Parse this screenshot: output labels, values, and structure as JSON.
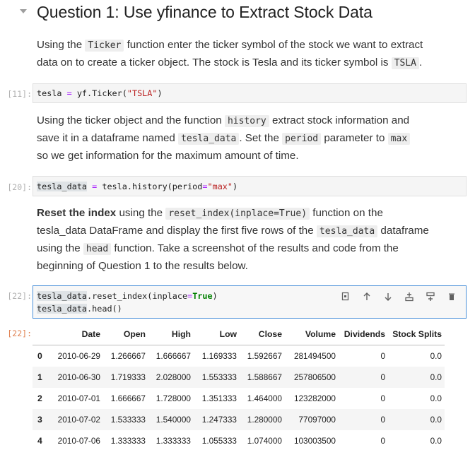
{
  "heading": {
    "title": "Question 1: Use yfinance to Extract Stock Data"
  },
  "md1": {
    "t1": "Using the ",
    "c1": "Ticker",
    "t2": " function enter the ticker symbol of the stock we want to extract",
    "t3": "data on to create a ticker object. The stock is Tesla and its ticker symbol is ",
    "c2": "TSLA",
    "t4": "."
  },
  "cell11": {
    "prompt": "[11]:",
    "a": "tesla",
    "op": " = ",
    "b": "yf.Ticker(",
    "str": "\"TSLA\"",
    "c": ")"
  },
  "md2": {
    "t1": "Using the ticker object and the function ",
    "c1": "history",
    "t2": " extract stock information and",
    "t3": "save it in a dataframe named ",
    "c2": "tesla_data",
    "t4": ". Set the ",
    "c3": "period",
    "t5": " parameter to ",
    "c4": "max",
    "t6": "so we get information for the maximum amount of time."
  },
  "cell20": {
    "prompt": "[20]:",
    "a": "tesla_data",
    "op": " = ",
    "b": "tesla.history(period",
    "eq": "=",
    "str": "\"max\"",
    "c": ")"
  },
  "md3": {
    "bold": "Reset the index",
    "t1": " using the ",
    "c1": "reset_index(inplace=True)",
    "t2": " function on the",
    "t3": "tesla_data DataFrame and display the first five rows of the ",
    "c2": "tesla_data",
    "t4": " dataframe",
    "t5": "using the ",
    "c3": "head",
    "t6": " function. Take a screenshot of the results and code from the",
    "t7": "beginning of Question 1 to the results below."
  },
  "cell22": {
    "prompt": "[22]:",
    "line1_first": "t",
    "line1_a": "esla_data",
    "line1_b": ".reset_index(inplace",
    "line1_eq": "=",
    "line1_kw": "True",
    "line1_c": ")",
    "line2_a": "tesla_data",
    "line2_b": ".head()",
    "out_prompt": "[22]:"
  },
  "toolbar": {
    "icons": [
      "duplicate-icon",
      "move-up-icon",
      "move-down-icon",
      "insert-above-icon",
      "insert-below-icon",
      "delete-icon"
    ]
  },
  "table": {
    "columns": [
      "",
      "Date",
      "Open",
      "High",
      "Low",
      "Close",
      "Volume",
      "Dividends",
      "Stock Splits"
    ],
    "rows": [
      [
        "0",
        "2010-06-29",
        "1.266667",
        "1.666667",
        "1.169333",
        "1.592667",
        "281494500",
        "0",
        "0.0"
      ],
      [
        "1",
        "2010-06-30",
        "1.719333",
        "2.028000",
        "1.553333",
        "1.588667",
        "257806500",
        "0",
        "0.0"
      ],
      [
        "2",
        "2010-07-01",
        "1.666667",
        "1.728000",
        "1.351333",
        "1.464000",
        "123282000",
        "0",
        "0.0"
      ],
      [
        "3",
        "2010-07-02",
        "1.533333",
        "1.540000",
        "1.247333",
        "1.280000",
        "77097000",
        "0",
        "0.0"
      ],
      [
        "4",
        "2010-07-06",
        "1.333333",
        "1.333333",
        "1.055333",
        "1.074000",
        "103003500",
        "0",
        "0.0"
      ]
    ]
  }
}
